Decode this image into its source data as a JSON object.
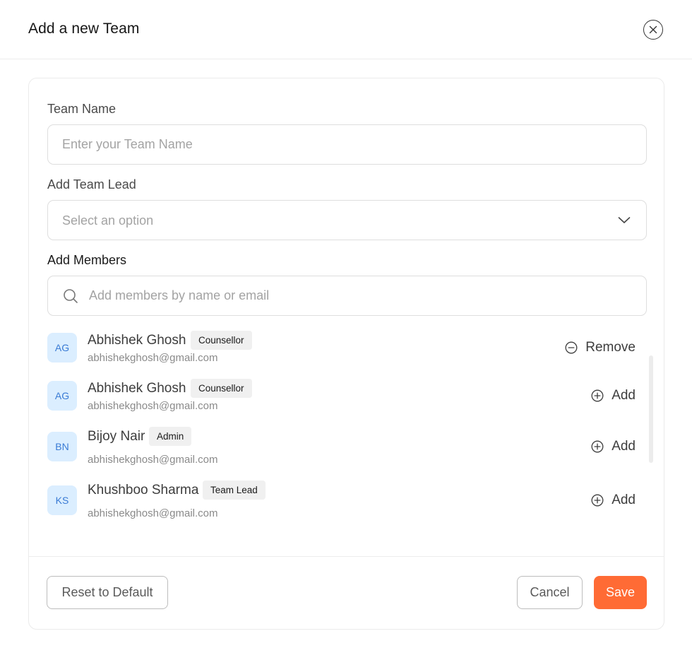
{
  "modal": {
    "title": "Add a new Team",
    "close_icon": "close-icon"
  },
  "team_name": {
    "label": "Team Name",
    "placeholder": "Enter your Team Name",
    "value": ""
  },
  "team_lead": {
    "label": "Add Team Lead",
    "placeholder": "Select an option"
  },
  "members": {
    "label": "Add Members",
    "search_placeholder": "Add members by name or email",
    "items": [
      {
        "initials": "AG",
        "name": "Abhishek Ghosh",
        "role": "Counsellor",
        "email": "abhishekghosh@gmail.com",
        "action": "Remove",
        "action_icon": "minus-circle-icon"
      },
      {
        "initials": "AG",
        "name": "Abhishek Ghosh",
        "role": "Counsellor",
        "email": "abhishekghosh@gmail.com",
        "action": "Add",
        "action_icon": "plus-circle-icon"
      },
      {
        "initials": "BN",
        "name": "Bijoy Nair",
        "role": "Admin",
        "email": "abhishekghosh@gmail.com",
        "action": "Add",
        "action_icon": "plus-circle-icon"
      },
      {
        "initials": "KS",
        "name": "Khushboo Sharma",
        "role": "Team Lead",
        "email": "abhishekghosh@gmail.com",
        "action": "Add",
        "action_icon": "plus-circle-icon"
      }
    ]
  },
  "footer": {
    "reset_label": "Reset to Default",
    "cancel_label": "Cancel",
    "save_label": "Save"
  },
  "colors": {
    "accent": "#ff6b35",
    "avatar_bg": "#dbeeff",
    "avatar_text": "#3a7bd5",
    "tag_bg": "#f0f0f0"
  }
}
